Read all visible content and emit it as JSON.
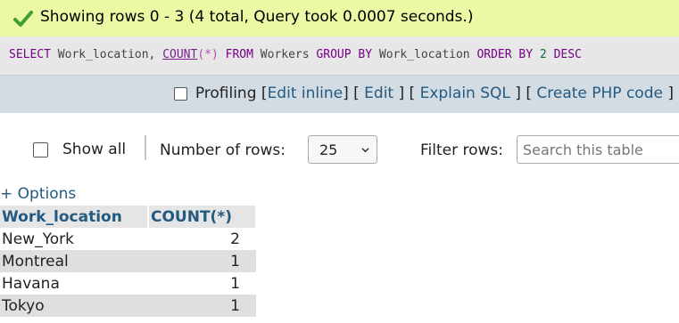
{
  "success": {
    "message": "Showing rows 0 - 3 (4 total, Query took 0.0007 seconds.)",
    "icon": "check-icon",
    "color": "#ebf8a4"
  },
  "sql": {
    "select": "SELECT",
    "col1": "Work_location",
    "comma": ",",
    "count_fn": "COUNT",
    "lparen": "(",
    "star": "*",
    "rparen": ")",
    "from": "FROM",
    "table": "Workers",
    "group_by": "GROUP BY",
    "group_col": "Work_location",
    "order_by": "ORDER BY",
    "order_num": "2",
    "desc": "DESC"
  },
  "tools": {
    "profiling": "Profiling",
    "edit_inline": "Edit inline",
    "edit": "Edit",
    "explain_sql": "Explain SQL",
    "create_php": "Create PHP code",
    "lb": "[",
    "rb": "]"
  },
  "nav": {
    "show_all": "Show all",
    "rows_label": "Number of rows:",
    "rows_value": "25",
    "filter_label": "Filter rows:",
    "filter_placeholder": "Search this table"
  },
  "options_label": "+ Options",
  "table": {
    "headers": [
      "Work_location",
      "COUNT(*)"
    ],
    "rows": [
      [
        "New_York",
        "2"
      ],
      [
        "Montreal",
        "1"
      ],
      [
        "Havana",
        "1"
      ],
      [
        "Tokyo",
        "1"
      ]
    ]
  },
  "colors": {
    "link": "#235a81",
    "tools_bg": "#d3dce3",
    "sql_bg": "#e7e7e7"
  }
}
